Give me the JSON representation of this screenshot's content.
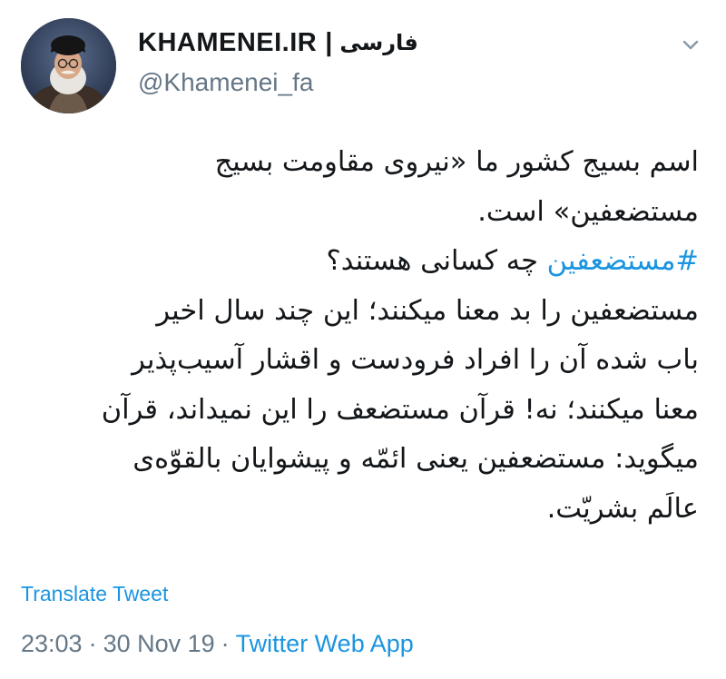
{
  "header": {
    "display_name": "KHAMENEI.IR",
    "separator": "|",
    "language_label": "فارسی",
    "handle": "@Khamenei_fa"
  },
  "icons": {
    "avatar": "profile-photo",
    "caret": "chevron-down-icon"
  },
  "tweet": {
    "lines": [
      "اسم بسیج کشور ما «نیروی مقاومت بسیج",
      "مستضعفین» است.",
      "",
      "مستضعفین را بد معنا میکنند؛ این چند سال اخیر",
      "باب شده آن را افراد فرودست و اقشار آسیب‌پذیر",
      "معنا میکنند؛ نه! قرآن مستضعف را این نمیداند، قرآن",
      "میگوید: مستضعفین یعنی ائمّه و پیشوایان بالقوّه‌ی",
      "عالَم بشریّت."
    ],
    "hashtag": "#مستضعفین",
    "hashtag_line_rest": "چه کسانی هستند؟"
  },
  "translate_label": "Translate Tweet",
  "meta": {
    "time": "23:03",
    "dot1": "·",
    "date": "30 Nov 19",
    "dot2": "·",
    "source": "Twitter Web App"
  },
  "colors": {
    "link": "#1b95e0",
    "muted": "#657786",
    "text": "#14171a"
  }
}
